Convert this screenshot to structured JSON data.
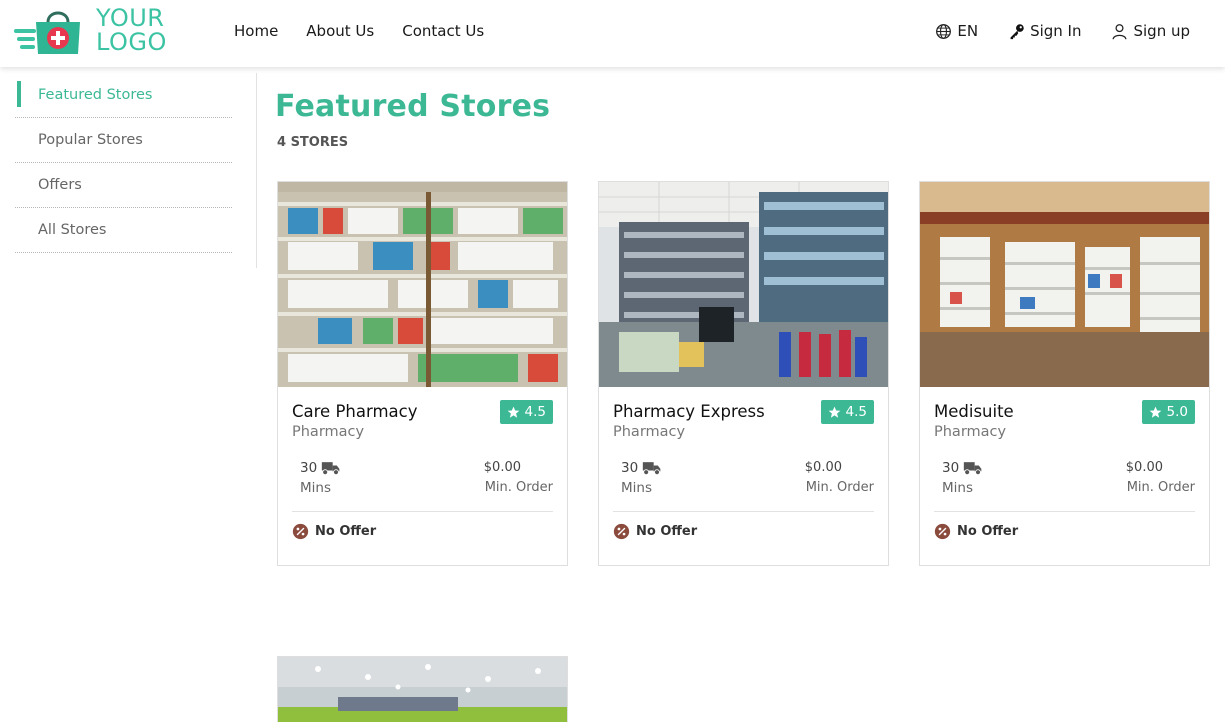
{
  "logo": {
    "line1": "YOUR",
    "line2": "LOGO"
  },
  "nav": {
    "home": "Home",
    "about": "About Us",
    "contact": "Contact Us"
  },
  "right_nav": {
    "language": "EN",
    "sign_in": "Sign In",
    "sign_up": "Sign up"
  },
  "sidebar": {
    "items": [
      {
        "label": "Featured Stores"
      },
      {
        "label": "Popular Stores"
      },
      {
        "label": "Offers"
      },
      {
        "label": "All Stores"
      }
    ]
  },
  "main": {
    "title": "Featured Stores",
    "count": "4 STORES"
  },
  "stores": [
    {
      "name": "Care Pharmacy",
      "category": "Pharmacy",
      "rating": "4.5",
      "time": "30",
      "time_unit": "Mins",
      "min_price": "$0.00",
      "min_label": "Min. Order",
      "offer": "No Offer"
    },
    {
      "name": "Pharmacy Express",
      "category": "Pharmacy",
      "rating": "4.5",
      "time": "30",
      "time_unit": "Mins",
      "min_price": "$0.00",
      "min_label": "Min. Order",
      "offer": "No Offer"
    },
    {
      "name": "Medisuite",
      "category": "Pharmacy",
      "rating": "5.0",
      "time": "30",
      "time_unit": "Mins",
      "min_price": "$0.00",
      "min_label": "Min. Order",
      "offer": "No Offer"
    }
  ],
  "colors": {
    "accent": "#3cb895",
    "logo": "#3cc3a3",
    "text": "#1a1a1a"
  }
}
